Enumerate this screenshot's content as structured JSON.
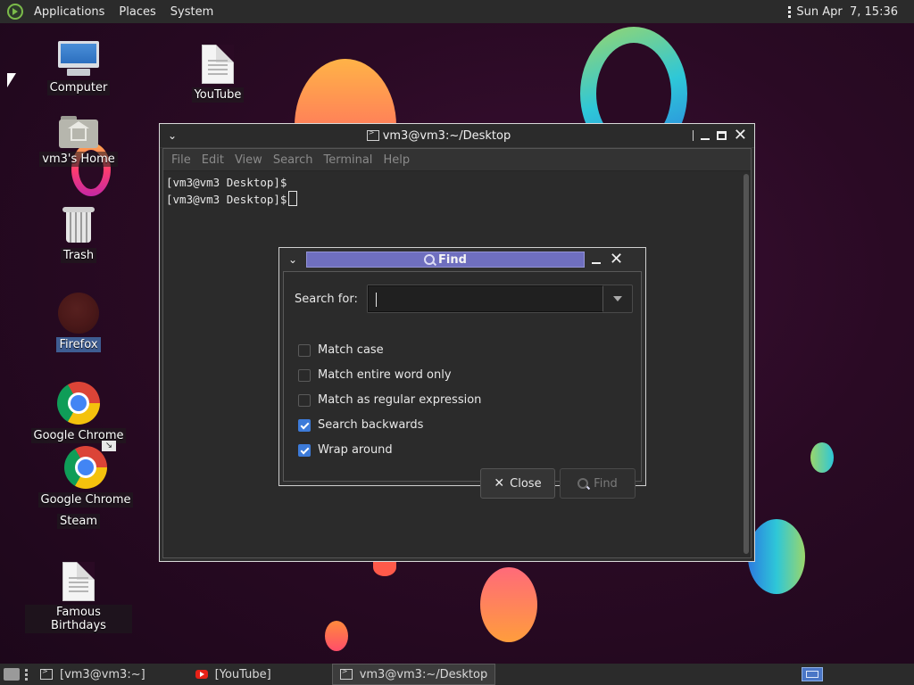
{
  "top_panel": {
    "menus": [
      "Applications",
      "Places",
      "System"
    ],
    "clock": "Sun Apr  7, 15:36"
  },
  "desktop_icons": [
    {
      "label": "Computer",
      "icon": "computer-icon"
    },
    {
      "label": "YouTube",
      "icon": "document-icon"
    },
    {
      "label": "vm3's Home",
      "icon": "home-folder-icon"
    },
    {
      "label": "Trash",
      "icon": "trash-icon"
    },
    {
      "label": "Firefox",
      "icon": "firefox-icon"
    },
    {
      "label": "Google Chrome",
      "icon": "chrome-icon"
    },
    {
      "label": "Google Chrome",
      "icon": "chrome-icon"
    },
    {
      "label": "Steam",
      "icon": "steam-icon"
    },
    {
      "label": "Famous Birthdays",
      "icon": "document-icon"
    }
  ],
  "terminal": {
    "title": "vm3@vm3:~/Desktop",
    "menu": [
      "File",
      "Edit",
      "View",
      "Search",
      "Terminal",
      "Help"
    ],
    "lines": [
      "[vm3@vm3 Desktop]$",
      "[vm3@vm3 Desktop]$"
    ]
  },
  "find_dialog": {
    "title": "Find",
    "search_label": "Search for:",
    "search_value": "",
    "options": [
      {
        "label": "Match case",
        "checked": false
      },
      {
        "label": "Match entire word only",
        "checked": false
      },
      {
        "label": "Match as regular expression",
        "checked": false
      },
      {
        "label": "Search backwards",
        "checked": true
      },
      {
        "label": "Wrap around",
        "checked": true
      }
    ],
    "close_label": "Close",
    "find_label": "Find",
    "find_enabled": false
  },
  "bottom_panel": {
    "tasks": [
      "[vm3@vm3:~]",
      "[YouTube]",
      "vm3@vm3:~/Desktop"
    ],
    "active_task": "vm3@vm3:~/Desktop"
  },
  "colors": {
    "accent": "#3d7bd9",
    "dialog_title_bg": "#6f6fbf",
    "desktop_bg": "#2a0a24"
  }
}
